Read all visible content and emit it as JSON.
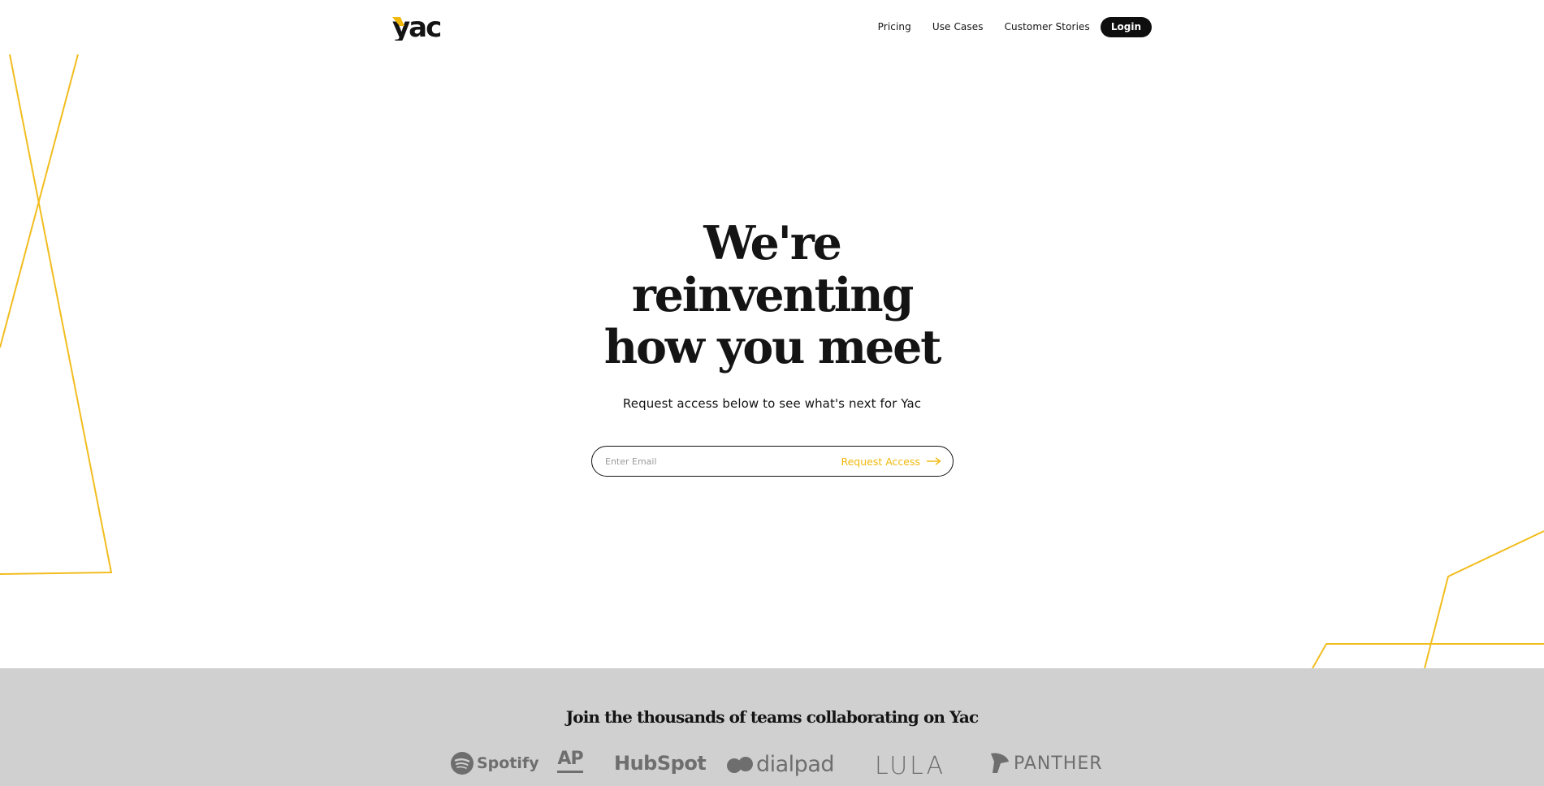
{
  "header": {
    "logo_text": "yac",
    "nav": [
      {
        "label": "Pricing"
      },
      {
        "label": "Use Cases"
      },
      {
        "label": "Customer Stories"
      }
    ],
    "login_label": "Login"
  },
  "hero": {
    "title_lines": [
      "We're",
      "reinventing",
      "how you meet"
    ],
    "subtitle": "Request access below to see what's next for Yac",
    "email_placeholder": "Enter Email",
    "cta_label": "Request Access"
  },
  "logos_section": {
    "title": "Join the thousands of teams collaborating on Yac",
    "brands": [
      "Spotify",
      "AP",
      "HubSpot",
      "dialpad",
      "LULA",
      "PANTHER"
    ]
  },
  "colors": {
    "accent": "#f0b90b",
    "text": "#141414",
    "band_bg": "#d0d0d0",
    "logo_gray": "#6e6e6e"
  }
}
